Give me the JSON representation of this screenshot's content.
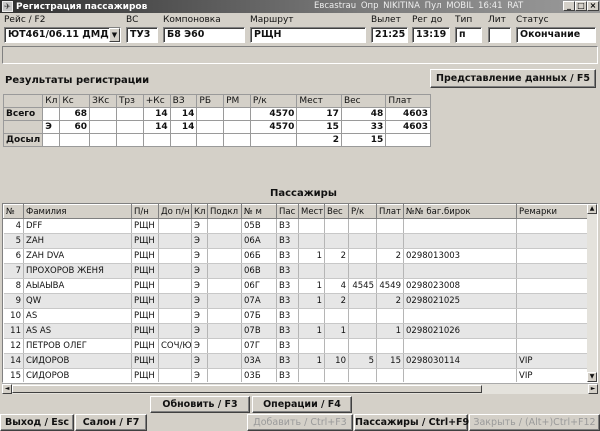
{
  "window": {
    "title": "Регистрация пассажиров",
    "status": "Евсastrau  Опр NIKITINA  Пул MOBIL  16:41  RAT",
    "minimize": "_",
    "maximize": "□",
    "close": "×"
  },
  "flight": {
    "labels": {
      "flight": "Рейс / F2",
      "aircraft": "ВС",
      "config": "Компоновка",
      "route": "Маршрут",
      "departure": "Вылет",
      "reg_until": "Рег до",
      "type": "Тип",
      "lit": "Лит",
      "status": "Статус"
    },
    "values": {
      "flight": "ЮТ461/06.11 ДМД",
      "aircraft": "ТУ3",
      "config": "Б8 Э60",
      "route": "РЩН",
      "departure": "21:25",
      "reg_until": "13:19",
      "type": "п",
      "lit": "",
      "status": "Окончание"
    },
    "dropdown_glyph": "▼"
  },
  "registration": {
    "title": "Результаты регистрации",
    "data_view_button": "Представление данных / F5",
    "columns": [
      "Кл",
      "Кс",
      "ЗКс",
      "Трз",
      "+Кс",
      "ВЗ",
      "РБ",
      "РМ",
      "Р/к",
      "Мест",
      "Вес",
      "Плат"
    ],
    "rows": [
      {
        "label": "Всего",
        "cells": [
          "",
          "68",
          "",
          "",
          "14",
          "14",
          "",
          "",
          "4570",
          "17",
          "48",
          "4603"
        ]
      },
      {
        "label": "",
        "cells": [
          "Э",
          "60",
          "",
          "",
          "14",
          "14",
          "",
          "",
          "4570",
          "15",
          "33",
          "4603"
        ]
      },
      {
        "label": "Досыл",
        "cells": [
          "",
          "",
          "",
          "",
          "",
          "",
          "",
          "",
          "",
          "2",
          "15",
          ""
        ]
      }
    ]
  },
  "passengers": {
    "title": "Пассажиры",
    "columns": [
      "№",
      "Фамилия",
      "П/н",
      "До п/н",
      "Кл",
      "Подкл",
      "№ м",
      "Пас",
      "Мест",
      "Вес",
      "Р/к",
      "Плат",
      "№№ баг.бирок",
      "Ремарки"
    ],
    "rows": [
      [
        "4",
        "DFF",
        "РЩН",
        "",
        "Э",
        "",
        "05В",
        "В3",
        "",
        "",
        "",
        "",
        "",
        ""
      ],
      [
        "5",
        "ZAH",
        "РЩН",
        "",
        "Э",
        "",
        "06А",
        "В3",
        "",
        "",
        "",
        "",
        "",
        ""
      ],
      [
        "6",
        "ZAH DVA",
        "РЩН",
        "",
        "Э",
        "",
        "06Б",
        "В3",
        "1",
        "2",
        "",
        "2",
        "0298013003",
        ""
      ],
      [
        "7",
        "ПРОХОРОВ ЖЕНЯ",
        "РЩН",
        "",
        "Э",
        "",
        "06В",
        "В3",
        "",
        "",
        "",
        "",
        "",
        ""
      ],
      [
        "8",
        "АЫАЫВА",
        "РЩН",
        "",
        "Э",
        "",
        "06Г",
        "В3",
        "1",
        "4",
        "4545",
        "4549",
        "0298023008",
        ""
      ],
      [
        "9",
        "QW",
        "РЩН",
        "",
        "Э",
        "",
        "07А",
        "В3",
        "1",
        "2",
        "",
        "2",
        "0298021025",
        ""
      ],
      [
        "10",
        "AS",
        "РЩН",
        "",
        "Э",
        "",
        "07Б",
        "В3",
        "",
        "",
        "",
        "",
        "",
        ""
      ],
      [
        "11",
        "AS AS",
        "РЩН",
        "",
        "Э",
        "",
        "07В",
        "В3",
        "1",
        "1",
        "",
        "1",
        "0298021026",
        ""
      ],
      [
        "12",
        "ПЕТРОВ ОЛЕГ",
        "РЩН",
        "СОЧ/ЮТ",
        "Э",
        "",
        "07Г",
        "В3",
        "",
        "",
        "",
        "",
        "",
        ""
      ],
      [
        "14",
        "СИДОРОВ",
        "РЩН",
        "",
        "Э",
        "",
        "03А",
        "В3",
        "1",
        "10",
        "5",
        "15",
        "0298030114",
        "VIP"
      ],
      [
        "15",
        "СИДОРОВ",
        "РЩН",
        "",
        "Э",
        "",
        "03Б",
        "В3",
        "",
        "",
        "",
        "",
        "",
        "VIP"
      ]
    ]
  },
  "actions": {
    "refresh": "Обновить / F3",
    "operations": "Операции / F4",
    "exit": "Выход / Esc",
    "cabin": "Салон / F7",
    "add": "Добавить / Ctrl+F3",
    "pax": "Пассажиры / Ctrl+F9",
    "close": "Закрыть / (Alt+)Ctrl+F12"
  },
  "scroll": {
    "up": "▲",
    "down": "▼",
    "left": "◄",
    "right": "►"
  }
}
